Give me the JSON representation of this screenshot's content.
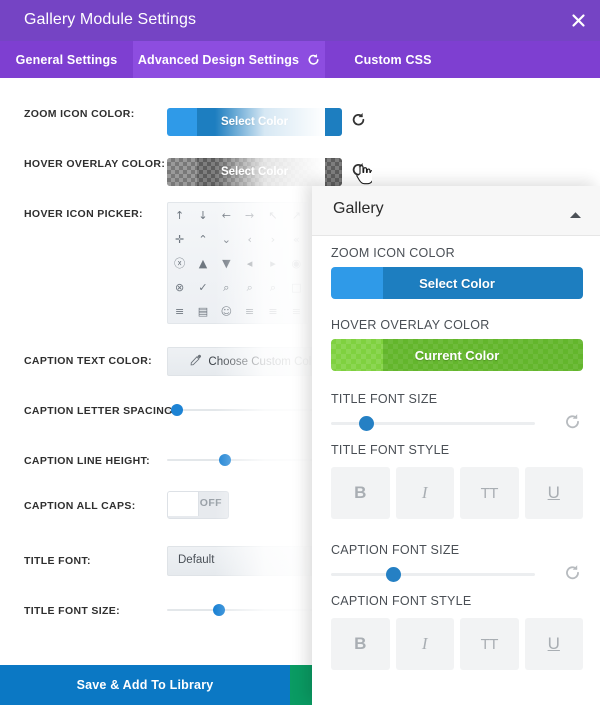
{
  "window": {
    "title": "Gallery Module Settings",
    "close_icon": "close-icon"
  },
  "tabs": [
    {
      "label": "General Settings",
      "active": false
    },
    {
      "label": "Advanced Design Settings",
      "active": true,
      "reset_icon": "reset-icon"
    },
    {
      "label": "Custom CSS",
      "active": false
    }
  ],
  "form": {
    "rows": [
      {
        "label": "ZOOM ICON COLOR:",
        "control": "color-button",
        "value": "Select Color",
        "colors": {
          "left": "#2f9ae8",
          "right": "#1d7ec0"
        },
        "reset": true
      },
      {
        "label": "HOVER OVERLAY COLOR:",
        "control": "color-button-transparent",
        "value": "Select Color",
        "reset": true
      },
      {
        "label": "HOVER ICON PICKER:",
        "control": "icon-grid"
      },
      {
        "label": "CAPTION TEXT COLOR:",
        "control": "custom-color",
        "value": "Choose Custom Color"
      },
      {
        "label": "CAPTION LETTER SPACING:",
        "control": "slider",
        "position_pct": 4
      },
      {
        "label": "CAPTION LINE HEIGHT:",
        "control": "slider",
        "position_pct": 38
      },
      {
        "label": "CAPTION ALL CAPS:",
        "control": "toggle",
        "value": "OFF"
      },
      {
        "label": "TITLE FONT:",
        "control": "select",
        "value": "Default"
      },
      {
        "label": "TITLE FONT SIZE:",
        "control": "slider",
        "position_pct": 34
      }
    ],
    "icon_grid": [
      "arrow-up-icon",
      "arrow-down-icon",
      "arrow-left-icon",
      "arrow-right-icon",
      "arrow-up-left-icon",
      "arrow-up-right-icon",
      "move-icon",
      "chevron-up-icon",
      "chevron-down-icon",
      "chevron-left-icon",
      "chevron-right-icon",
      "chevrons-up-icon",
      "circle-x-icon",
      "triangle-up-icon",
      "triangle-down-icon",
      "triangle-left-icon",
      "triangle-right-icon",
      "circle-triangle-icon",
      "close-circle-icon",
      "check-circle-icon",
      "search-left-icon",
      "zoom-in-icon",
      "zoom-icon",
      "square-icon",
      "list-icon",
      "document-icon",
      "smiley-icon",
      "align-left-icon",
      "align-right-icon",
      "sliders-icon"
    ]
  },
  "footer": {
    "save_label": "Save & Add To Library",
    "save_color": "#0b78c4",
    "accent_color": "#0a9b63"
  },
  "overlay": {
    "title": "Gallery",
    "collapse_icon": "chevron-up-icon",
    "sections": [
      {
        "label": "ZOOM ICON COLOR",
        "control": "color-button",
        "value": "Select Color",
        "colors": {
          "left": "#2f9ae8",
          "right": "#1d7ec0"
        }
      },
      {
        "label": "HOVER OVERLAY COLOR",
        "control": "color-button",
        "value": "Current Color",
        "colors": {
          "left": "#7fd13f",
          "right": "#63b62c"
        }
      },
      {
        "label": "TITLE FONT SIZE",
        "control": "slider",
        "position_pct": 14,
        "reset": true
      },
      {
        "label": "TITLE FONT STYLE",
        "control": "style-buttons",
        "buttons": [
          "B",
          "I",
          "TT",
          "U"
        ]
      },
      {
        "label": "CAPTION FONT SIZE",
        "control": "slider",
        "position_pct": 28,
        "reset": true
      },
      {
        "label": "CAPTION FONT STYLE",
        "control": "style-buttons",
        "buttons": [
          "B",
          "I",
          "TT",
          "U"
        ]
      }
    ],
    "style_button_names": [
      "bold-button",
      "italic-button",
      "uppercase-button",
      "underline-button"
    ]
  },
  "cursor": {
    "type": "pointing-hand-cursor"
  }
}
